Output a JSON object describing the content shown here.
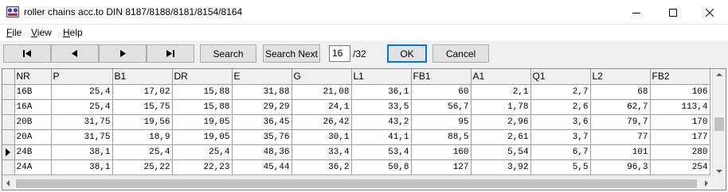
{
  "window": {
    "title": "roller chains acc.to DIN 8187/8188/8181/8154/8164",
    "icon": "app-icon",
    "controls": [
      "minimize-icon",
      "maximize-icon",
      "close-icon"
    ]
  },
  "menu": {
    "file": {
      "label": "File",
      "mnemonic": "F",
      "rest": "ile"
    },
    "view": {
      "label": "View",
      "mnemonic": "V",
      "rest": "iew"
    },
    "help": {
      "label": "Help",
      "mnemonic": "H",
      "rest": "elp"
    }
  },
  "toolbar": {
    "nav_icons": [
      "first-record-icon",
      "previous-record-icon",
      "next-record-icon",
      "last-record-icon"
    ],
    "search_label": "Search",
    "search_next_label": "Search Next",
    "page_value": "16",
    "page_total": "/32",
    "ok_label": "OK",
    "cancel_label": "Cancel"
  },
  "grid": {
    "columns": [
      "NR",
      "P",
      "B1",
      "DR",
      "E",
      "G",
      "L1",
      "FB1",
      "A1",
      "Q1",
      "L2",
      "FB2"
    ],
    "rows": [
      [
        "16B",
        "25,4",
        "17,02",
        "15,88",
        "31,88",
        "21,08",
        "36,1",
        "60",
        "2,1",
        "2,7",
        "68",
        "106"
      ],
      [
        "16A",
        "25,4",
        "15,75",
        "15,88",
        "29,29",
        "24,1",
        "33,5",
        "56,7",
        "1,78",
        "2,6",
        "62,7",
        "113,4"
      ],
      [
        "20B",
        "31,75",
        "19,56",
        "19,05",
        "36,45",
        "26,42",
        "43,2",
        "95",
        "2,96",
        "3,6",
        "79,7",
        "170"
      ],
      [
        "20A",
        "31,75",
        "18,9",
        "19,05",
        "35,76",
        "30,1",
        "41,1",
        "88,5",
        "2,61",
        "3,7",
        "77",
        "177"
      ],
      [
        "24B",
        "38,1",
        "25,4",
        "25,4",
        "48,36",
        "33,4",
        "53,4",
        "160",
        "5,54",
        "6,7",
        "101",
        "280"
      ],
      [
        "24A",
        "38,1",
        "25,22",
        "22,23",
        "45,44",
        "36,2",
        "50,8",
        "127",
        "3,92",
        "5,5",
        "96,3",
        "254"
      ]
    ],
    "current_row_index": 4
  },
  "colors": {
    "ok_border": "#0078d7",
    "button_bg": "#e1e1e1",
    "grid_line": "#a0a0a0"
  }
}
